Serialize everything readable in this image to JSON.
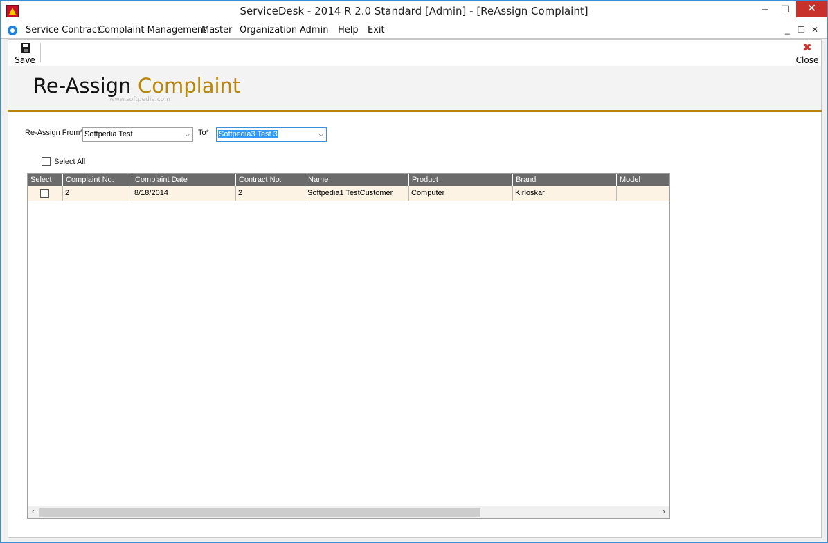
{
  "window": {
    "title": "ServiceDesk - 2014 R 2.0 Standard [Admin] - [ReAssign Complaint]",
    "min_glyph": "─",
    "max_glyph": "☐",
    "close_glyph": "✕"
  },
  "menu": {
    "items": [
      "Service Contract",
      "Complaint Management",
      "Master",
      "Organization",
      "Admin",
      "Help",
      "Exit"
    ],
    "mdi_min": "_",
    "mdi_restore": "❐",
    "mdi_close": "✕"
  },
  "toolbar": {
    "save_label": "Save",
    "close_label": "Close"
  },
  "page": {
    "title_part1": "Re-Assign",
    "title_part2": "Complaint",
    "watermark": "www.softpedia.com"
  },
  "form": {
    "from_label": "Re-Assign From*",
    "from_value": "Softpedia Test",
    "to_label": "To*",
    "to_value": "Softpedia3 Test 3",
    "select_all_label": "Select All"
  },
  "grid": {
    "columns": [
      "Select",
      "Complaint No.",
      "Complaint Date",
      "Contract No.",
      "Name",
      "Product",
      "Brand",
      "Model"
    ],
    "rows": [
      {
        "select": false,
        "complaint_no": "2",
        "complaint_date": "8/18/2014",
        "contract_no": "2",
        "name": "Softpedia1 TestCustomer",
        "product": "Computer",
        "brand": "Kirloskar",
        "model": ""
      }
    ]
  },
  "colors": {
    "accent_gold": "#b8860b",
    "header_gray": "#6b6b6b",
    "row_bg": "#fdf3e4",
    "selection_blue": "#3399ff"
  }
}
